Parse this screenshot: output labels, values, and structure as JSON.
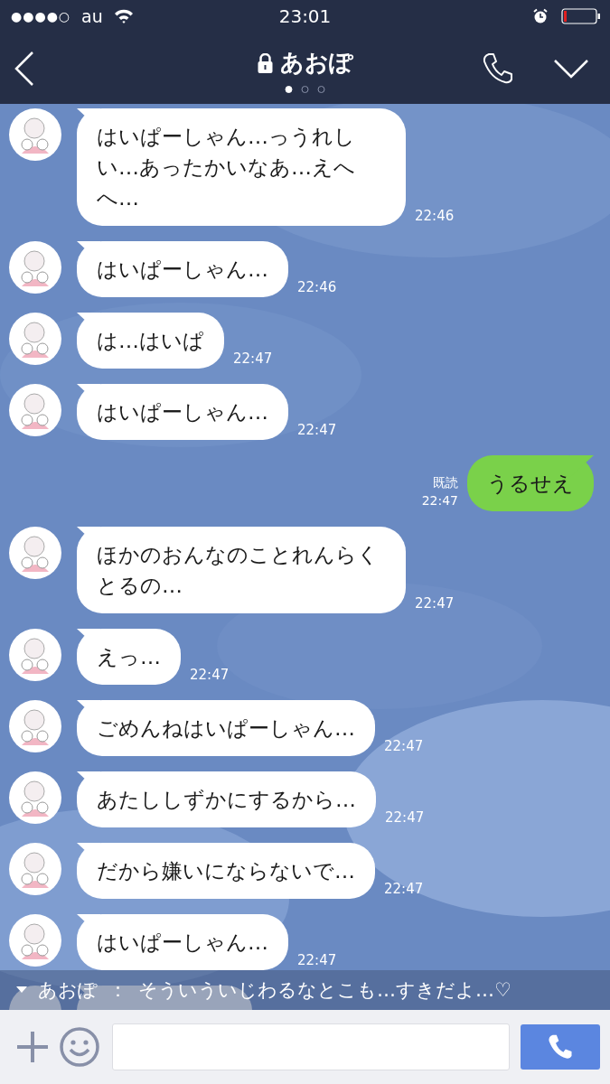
{
  "status_bar": {
    "signal": "●●●●○",
    "carrier": "au",
    "time": "23:01"
  },
  "header": {
    "title": "あおぽ",
    "pages": [
      {
        "selected": true
      },
      {
        "selected": false
      },
      {
        "selected": false
      }
    ]
  },
  "messages": [
    {
      "kind": "received",
      "text": "はいぱーしゃん…っうれしい…あったかいなあ…えへへ…",
      "time": "22:46"
    },
    {
      "kind": "received",
      "text": "はいぱーしゃん…",
      "time": "22:46"
    },
    {
      "kind": "received",
      "text": "は…はいぱ",
      "time": "22:47"
    },
    {
      "kind": "received",
      "text": "はいぱーしゃん…",
      "time": "22:47"
    },
    {
      "kind": "sent",
      "text": "うるせえ",
      "read": "既読",
      "time": "22:47"
    },
    {
      "kind": "received",
      "text": "ほかのおんなのことれんらくとるの…",
      "time": "22:47"
    },
    {
      "kind": "received",
      "text": "えっ…",
      "time": "22:47"
    },
    {
      "kind": "received",
      "text": "ごめんねはいぱーしゃん…",
      "time": "22:47"
    },
    {
      "kind": "received",
      "text": "あたししずかにするから…",
      "time": "22:47"
    },
    {
      "kind": "received",
      "text": "だから嫌いにならないで…",
      "time": "22:47"
    },
    {
      "kind": "received",
      "text": "はいぱーしゃん…",
      "time": "22:47"
    }
  ],
  "notice": {
    "sender": "あおぽ",
    "separator": "：",
    "text": "そういういじわるなとこも…すきだよ…♡"
  }
}
